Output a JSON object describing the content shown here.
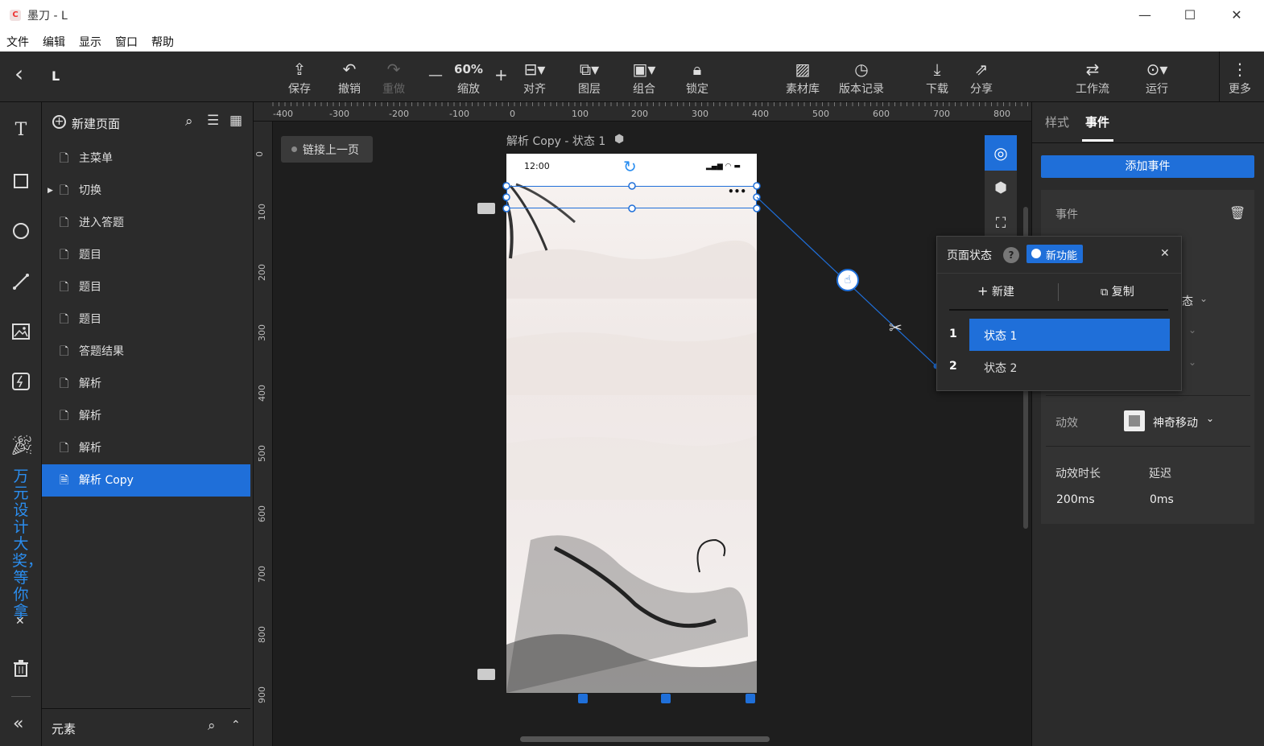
{
  "window": {
    "app_title": "墨刀 - L",
    "minimize": "—",
    "maximize": "☐",
    "close": "✕"
  },
  "menu": [
    "文件",
    "编辑",
    "显示",
    "窗口",
    "帮助"
  ],
  "toolbar": {
    "back": "‹",
    "project": "L",
    "save": "保存",
    "undo": "撤销",
    "redo": "重做",
    "zoom_value": "60%",
    "zoom_label": "缩放",
    "zoom_minus": "—",
    "zoom_plus": "+",
    "align": "对齐",
    "layers": "图层",
    "group": "组合",
    "lock": "锁定",
    "assets": "素材库",
    "history": "版本记录",
    "download": "下载",
    "share": "分享",
    "workflow": "工作流",
    "run": "运行",
    "more": "更多"
  },
  "tools": {
    "text": "T",
    "promo": "万元设计大奖，等你拿",
    "promo_close": "✕",
    "collapse": "«"
  },
  "pages": {
    "new_page": "新建页面",
    "items": [
      {
        "label": "主菜单"
      },
      {
        "label": "切换",
        "expandable": true
      },
      {
        "label": "进入答题"
      },
      {
        "label": "题目"
      },
      {
        "label": "题目"
      },
      {
        "label": "题目"
      },
      {
        "label": "答题结果"
      },
      {
        "label": "解析"
      },
      {
        "label": "解析"
      },
      {
        "label": "解析"
      },
      {
        "label": "解析 Copy",
        "active": true
      }
    ],
    "elements_label": "元素"
  },
  "canvas": {
    "link_prev": "链接上一页",
    "frame_title": "解析 Copy - 状态 1",
    "phone_time": "12:00",
    "ruler_h": [
      "-400",
      "-300",
      "-200",
      "-100",
      "0",
      "100",
      "200",
      "300",
      "400",
      "500",
      "600",
      "700",
      "800"
    ],
    "ruler_v": [
      "0",
      "100",
      "200",
      "300",
      "400",
      "500",
      "600",
      "700",
      "800",
      "900"
    ]
  },
  "right_panel": {
    "tab_style": "样式",
    "tab_event": "事件",
    "add_event": "添加事件",
    "event_label": "事件",
    "state_suffix": "态",
    "animation_label": "动效",
    "animation_value": "神奇移动",
    "duration_label": "动效时长",
    "delay_label": "延迟",
    "duration_value": "200ms",
    "delay_value": "0ms"
  },
  "popup": {
    "title": "页面状态",
    "help": "?",
    "new_feature": "新功能",
    "close": "✕",
    "new_btn": "新建",
    "copy_btn": "复制",
    "states": [
      {
        "index": "1",
        "label": "状态 1",
        "active": true
      },
      {
        "index": "2",
        "label": "状态 2",
        "active": false
      }
    ]
  },
  "colors": {
    "accent": "#1f6fd9",
    "toolbar_bg": "#2b2b2b",
    "canvas_bg": "#1e1e1e"
  }
}
